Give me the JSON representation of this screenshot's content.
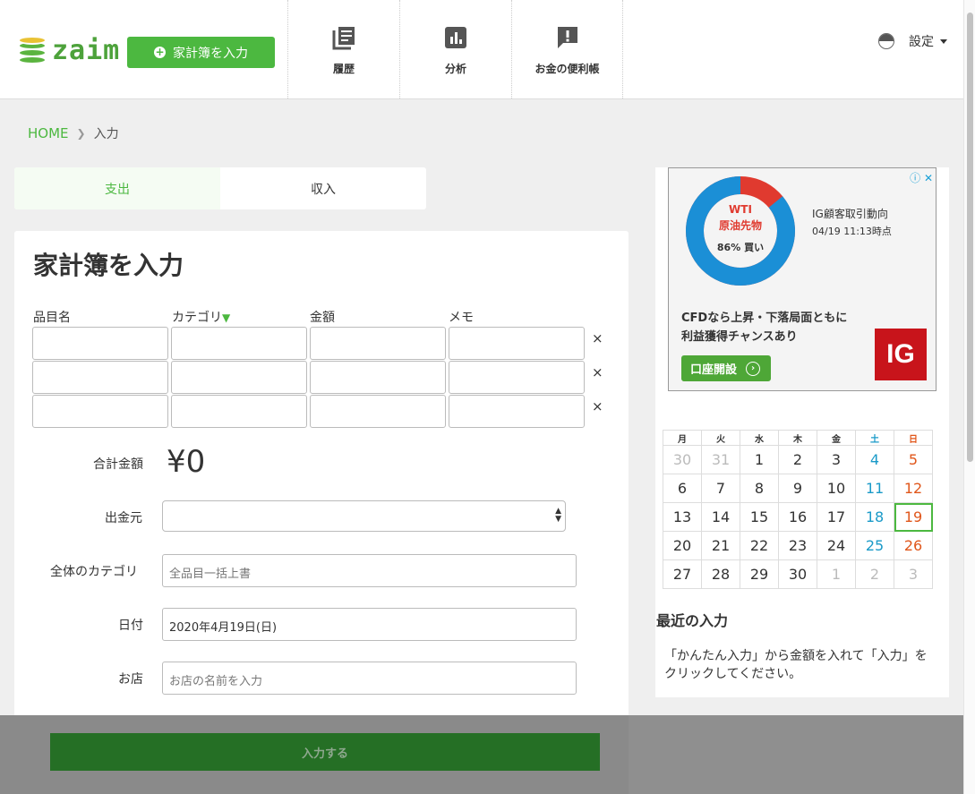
{
  "header": {
    "logo_text": "zaim",
    "entry_button": "家計簿を入力",
    "nav": [
      {
        "label": "履歴",
        "icon": "book-icon"
      },
      {
        "label": "分析",
        "icon": "bar-chart-icon"
      },
      {
        "label": "お金の便利帳",
        "icon": "alert-bubble-icon"
      }
    ],
    "settings_label": "設定"
  },
  "breadcrumb": {
    "home": "HOME",
    "current": "入力"
  },
  "tabs": [
    {
      "label": "支出",
      "active": true
    },
    {
      "label": "収入",
      "active": false
    }
  ],
  "form": {
    "title": "家計簿を入力",
    "columns": [
      "品目名",
      "カテゴリ",
      "金額",
      "メモ"
    ],
    "category_marker": "▼",
    "remove_glyph": "×",
    "total_label": "合計金額",
    "total_value": "¥0",
    "source_label": "出金元",
    "source_value": "",
    "category_label": "全体のカテゴリ",
    "category_placeholder": "全品目一括上書",
    "date_label": "日付",
    "date_value": "2020年4月19日(日)",
    "shop_label": "お店",
    "shop_placeholder": "お店の名前を入力",
    "submit_label": "入力する"
  },
  "ad": {
    "donut_label_1": "WTI",
    "donut_label_2": "原油先物",
    "donut_label_3": "86% 買い",
    "buy_percent": 86,
    "title": "IG顧客取引動向",
    "time": "04/19 11:13時点",
    "copy_line1": "CFDなら上昇・下落局面ともに",
    "copy_line2": "利益獲得チャンスあり",
    "button": "口座開設",
    "logo": "IG",
    "colors": {
      "buy": "#1b8fd6",
      "sell": "#e03a2f"
    }
  },
  "calendar": {
    "weekdays": [
      "月",
      "火",
      "水",
      "木",
      "金",
      "土",
      "日"
    ],
    "weeks": [
      [
        "30",
        "31",
        "1",
        "2",
        "3",
        "4",
        "5"
      ],
      [
        "6",
        "7",
        "8",
        "9",
        "10",
        "11",
        "12"
      ],
      [
        "13",
        "14",
        "15",
        "16",
        "17",
        "18",
        "19"
      ],
      [
        "20",
        "21",
        "22",
        "23",
        "24",
        "25",
        "26"
      ],
      [
        "27",
        "28",
        "29",
        "30",
        "1",
        "2",
        "3"
      ]
    ],
    "today": "19"
  },
  "recent": {
    "title": "最近の入力",
    "text": "「かんたん入力」から金額を入れて「入力」をクリックしてください。"
  },
  "colors": {
    "brand": "#4cb840",
    "saturday": "#1a9ac8",
    "sunday": "#e0561a"
  }
}
